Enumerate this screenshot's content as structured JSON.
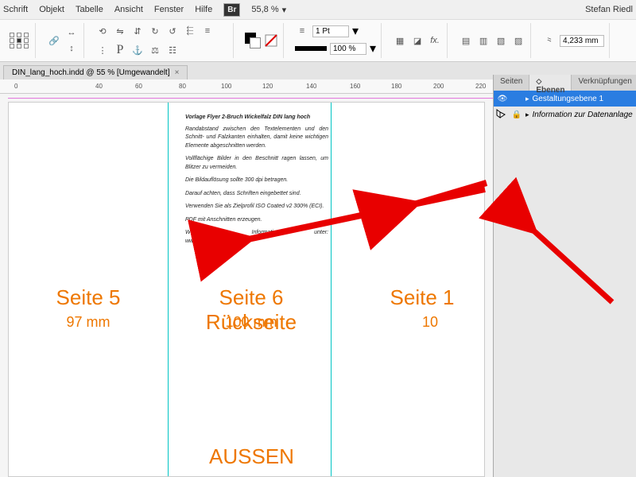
{
  "menu": {
    "schrift": "Schrift",
    "objekt": "Objekt",
    "tabelle": "Tabelle",
    "ansicht": "Ansicht",
    "fenster": "Fenster",
    "hilfe": "Hilfe",
    "zoom": "55,8 %",
    "user": "Stefan Riedl"
  },
  "toolbar": {
    "stroke": "1 Pt",
    "scale": "100 %",
    "field1": "4,233 mm"
  },
  "tab": {
    "title": "DIN_lang_hoch.indd @ 55 % [Umgewandelt]"
  },
  "ruler": {
    "t0": "0",
    "t40": "40",
    "t60": "60",
    "t80": "80",
    "t100": "100",
    "t120": "120",
    "t140": "140",
    "t160": "160",
    "t180": "180",
    "t200": "200",
    "t220": "220"
  },
  "doc": {
    "title": "Vorlage Flyer 2-Bruch Wickelfalz  DIN lang hoch",
    "p1": "Randabstand zwischen den Textelementen und den Schnitt- und Falzkanten einhalten, damit keine wichtigen Elemente abgeschnitten werden.",
    "p2": "Vollflächige Bilder in den Beschnitt ragen lassen, um Blitzer zu vermeiden.",
    "p3": "Die Bildauflösung sollte 300 dpi betragen.",
    "p4": "Darauf achten, dass Schriften eingebettet sind.",
    "p5": "Verwenden Sie als Zielprofil ISO Coated v2 300% (ECI).",
    "p6": "PDF mit Anschnitten erzeugen.",
    "p7": "Weiterführende Informationen unter: www.viaprinto.de/hilfe",
    "s5": "Seite 5",
    "s5mm": "97 mm",
    "s6": "Seite 6 Rückseite",
    "s6mm": "100 mm",
    "s1": "Seite 1",
    "s1mm": "10",
    "aussen": "AUSSEN"
  },
  "panel": {
    "seiten": "Seiten",
    "ebenen": "Ebenen",
    "verk": "Verknüpfungen",
    "layer1": "Gestaltungsebene 1",
    "layer2": "Information zur Datenanlage"
  }
}
